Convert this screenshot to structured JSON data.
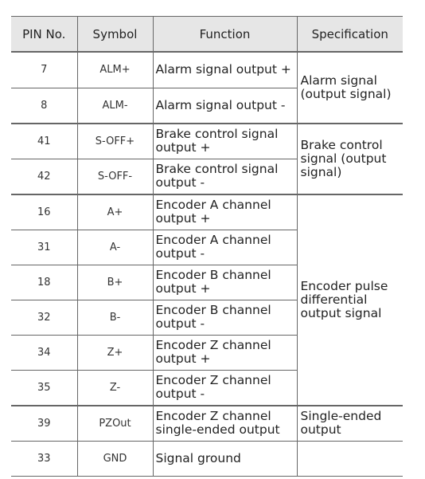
{
  "headers": [
    "PIN No.",
    "Symbol",
    "Function",
    "Specification"
  ],
  "rows": [
    {
      "pin": "7",
      "symbol": "ALM+",
      "function": "Alarm signal output +"
    },
    {
      "pin": "8",
      "symbol": "ALM-",
      "function": "Alarm signal output -"
    },
    {
      "pin": "41",
      "symbol": "S-OFF+",
      "function": "Brake control signal output +"
    },
    {
      "pin": "42",
      "symbol": "S-OFF-",
      "function": "Brake control signal output -"
    },
    {
      "pin": "16",
      "symbol": "A+",
      "function": "Encoder A channel output +"
    },
    {
      "pin": "31",
      "symbol": "A-",
      "function": "Encoder A channel output -"
    },
    {
      "pin": "18",
      "symbol": "B+",
      "function": "Encoder B channel output +"
    },
    {
      "pin": "32",
      "symbol": "B-",
      "function": "Encoder B channel output -"
    },
    {
      "pin": "34",
      "symbol": "Z+",
      "function": "Encoder Z channel output +"
    },
    {
      "pin": "35",
      "symbol": "Z-",
      "function": "Encoder Z channel output -"
    },
    {
      "pin": "39",
      "symbol": "PZOut",
      "function": "Encoder Z channel single-ended output"
    },
    {
      "pin": "33",
      "symbol": "GND",
      "function": "Signal ground"
    }
  ],
  "specs": {
    "alarm": "Alarm signal (output signal)",
    "brake": "Brake control signal (output signal)",
    "encoder": "Encoder pulse differential output signal",
    "single": "Single-ended output",
    "gnd": ""
  }
}
